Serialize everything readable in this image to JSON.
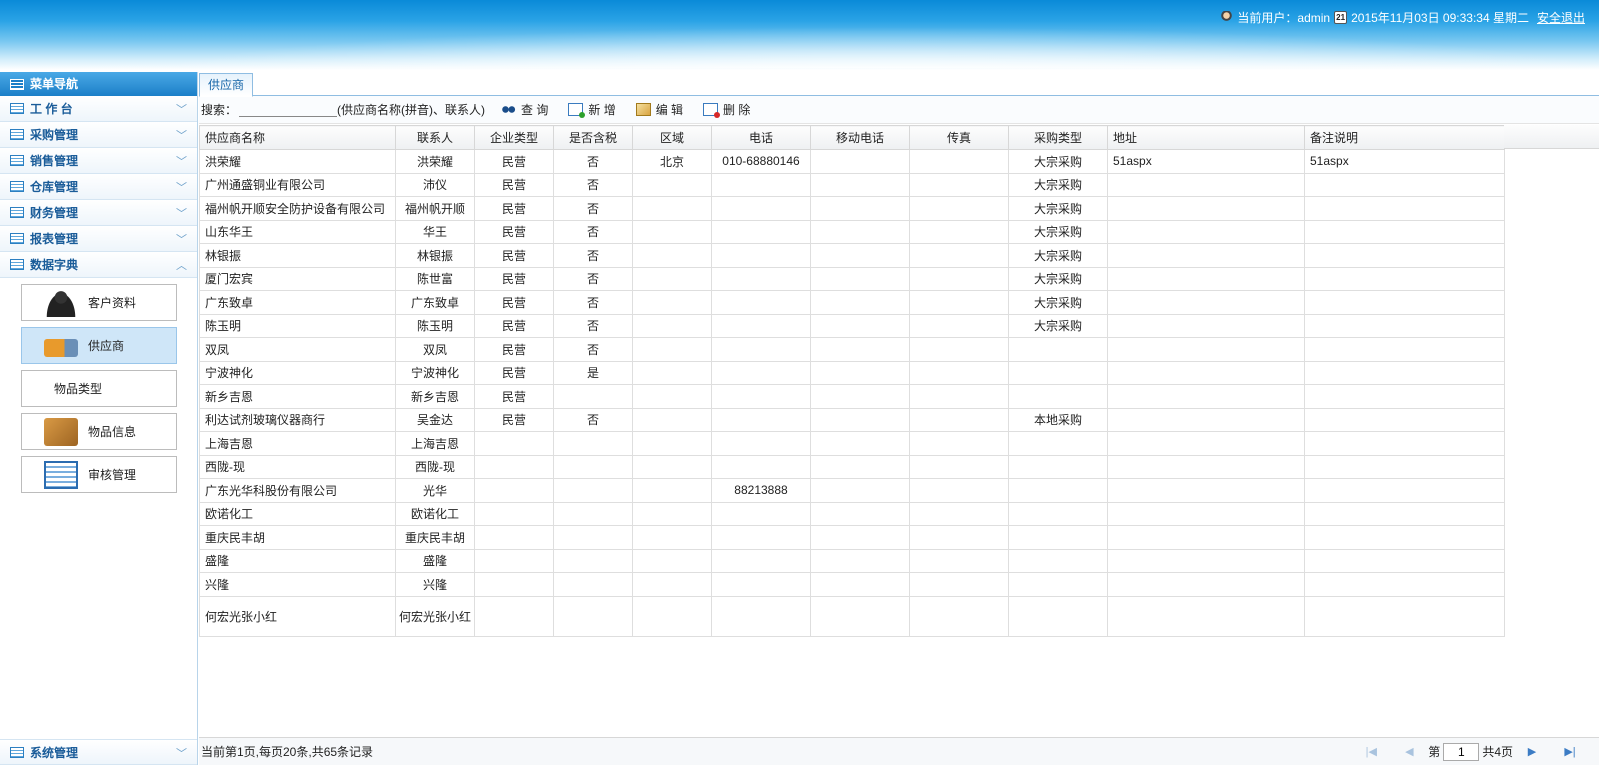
{
  "header": {
    "user_text": "当前用户：admin",
    "calendar_day": "21",
    "datetime": "2015年11月03日 09:33:34 星期二",
    "logout": "安全退出"
  },
  "sidebar": {
    "title": "菜单导航",
    "groups": [
      {
        "label": "工 作 台",
        "chevron": "﹀"
      },
      {
        "label": "采购管理",
        "chevron": "﹀"
      },
      {
        "label": "销售管理",
        "chevron": "﹀"
      },
      {
        "label": "仓库管理",
        "chevron": "﹀"
      },
      {
        "label": "财务管理",
        "chevron": "﹀"
      },
      {
        "label": "报表管理",
        "chevron": "﹀"
      },
      {
        "label": "数据字典",
        "chevron": "︿"
      }
    ],
    "sub_items": [
      {
        "label": "客户资料",
        "icon": "person-icon"
      },
      {
        "label": "供应商",
        "icon": "truck-icon"
      },
      {
        "label": "物品类型",
        "icon": ""
      },
      {
        "label": "物品信息",
        "icon": "box-icon"
      },
      {
        "label": "审核管理",
        "icon": "document-icon"
      }
    ],
    "system": {
      "label": "系统管理",
      "chevron": "﹀"
    }
  },
  "tab": {
    "label": "供应商"
  },
  "toolbar": {
    "search_label": "搜索：",
    "search_value": "",
    "search_hint": "(供应商名称(拼音)、联系人)",
    "query": "查 询",
    "add": "新 增",
    "edit": "编 辑",
    "delete": "删 除"
  },
  "table": {
    "columns": [
      "供应商名称",
      "联系人",
      "企业类型",
      "是否含税",
      "区域",
      "电话",
      "移动电话",
      "传真",
      "采购类型",
      "地址",
      "备注说明"
    ],
    "rows": [
      [
        "洪荣耀",
        "洪荣耀",
        "民营",
        "否",
        "北京",
        "010-68880146",
        "",
        "",
        "大宗采购",
        "51aspx",
        "51aspx"
      ],
      [
        "广州通盛铜业有限公司",
        "沛仪",
        "民营",
        "否",
        "",
        "",
        "",
        "",
        "大宗采购",
        "",
        ""
      ],
      [
        "福州帆开顺安全防护设备有限公司",
        "福州帆开顺",
        "民营",
        "否",
        "",
        "",
        "",
        "",
        "大宗采购",
        "",
        ""
      ],
      [
        "山东华王",
        "华王",
        "民营",
        "否",
        "",
        "",
        "",
        "",
        "大宗采购",
        "",
        ""
      ],
      [
        "林银振",
        "林银振",
        "民营",
        "否",
        "",
        "",
        "",
        "",
        "大宗采购",
        "",
        ""
      ],
      [
        "厦门宏宾",
        "陈世富",
        "民营",
        "否",
        "",
        "",
        "",
        "",
        "大宗采购",
        "",
        ""
      ],
      [
        "广东致卓",
        "广东致卓",
        "民营",
        "否",
        "",
        "",
        "",
        "",
        "大宗采购",
        "",
        ""
      ],
      [
        "陈玉明",
        "陈玉明",
        "民营",
        "否",
        "",
        "",
        "",
        "",
        "大宗采购",
        "",
        ""
      ],
      [
        "双凤",
        "双凤",
        "民营",
        "否",
        "",
        "",
        "",
        "",
        "",
        "",
        ""
      ],
      [
        "宁波神化",
        "宁波神化",
        "民营",
        "是",
        "",
        "",
        "",
        "",
        "",
        "",
        ""
      ],
      [
        "新乡吉恩",
        "新乡吉恩",
        "民营",
        "",
        "",
        "",
        "",
        "",
        "",
        "",
        ""
      ],
      [
        "利达试剂玻璃仪器商行",
        "吴金达",
        "民营",
        "否",
        "",
        "",
        "",
        "",
        "本地采购",
        "",
        ""
      ],
      [
        "上海吉恩",
        "上海吉恩",
        "",
        "",
        "",
        "",
        "",
        "",
        "",
        "",
        ""
      ],
      [
        "西陇-现",
        "西陇-现",
        "",
        "",
        "",
        "",
        "",
        "",
        "",
        "",
        ""
      ],
      [
        "广东光华科股份有限公司",
        "光华",
        "",
        "",
        "",
        "88213888",
        "",
        "",
        "",
        "",
        ""
      ],
      [
        "欧诺化工",
        "欧诺化工",
        "",
        "",
        "",
        "",
        "",
        "",
        "",
        "",
        ""
      ],
      [
        "重庆民丰胡",
        "重庆民丰胡",
        "",
        "",
        "",
        "",
        "",
        "",
        "",
        "",
        ""
      ],
      [
        "盛隆",
        "盛隆",
        "",
        "",
        "",
        "",
        "",
        "",
        "",
        "",
        ""
      ],
      [
        "兴隆",
        "兴隆",
        "",
        "",
        "",
        "",
        "",
        "",
        "",
        "",
        ""
      ],
      [
        "何宏光张小红",
        "何宏光张小红",
        "",
        "",
        "",
        "",
        "",
        "",
        "",
        "",
        ""
      ]
    ]
  },
  "pager": {
    "info": "当前第1页,每页20条,共65条记录",
    "page_prefix": "第",
    "page_value": "1",
    "page_suffix": "共4页",
    "first": "|◀",
    "prev": "◀",
    "next": "▶",
    "last": "▶|"
  }
}
